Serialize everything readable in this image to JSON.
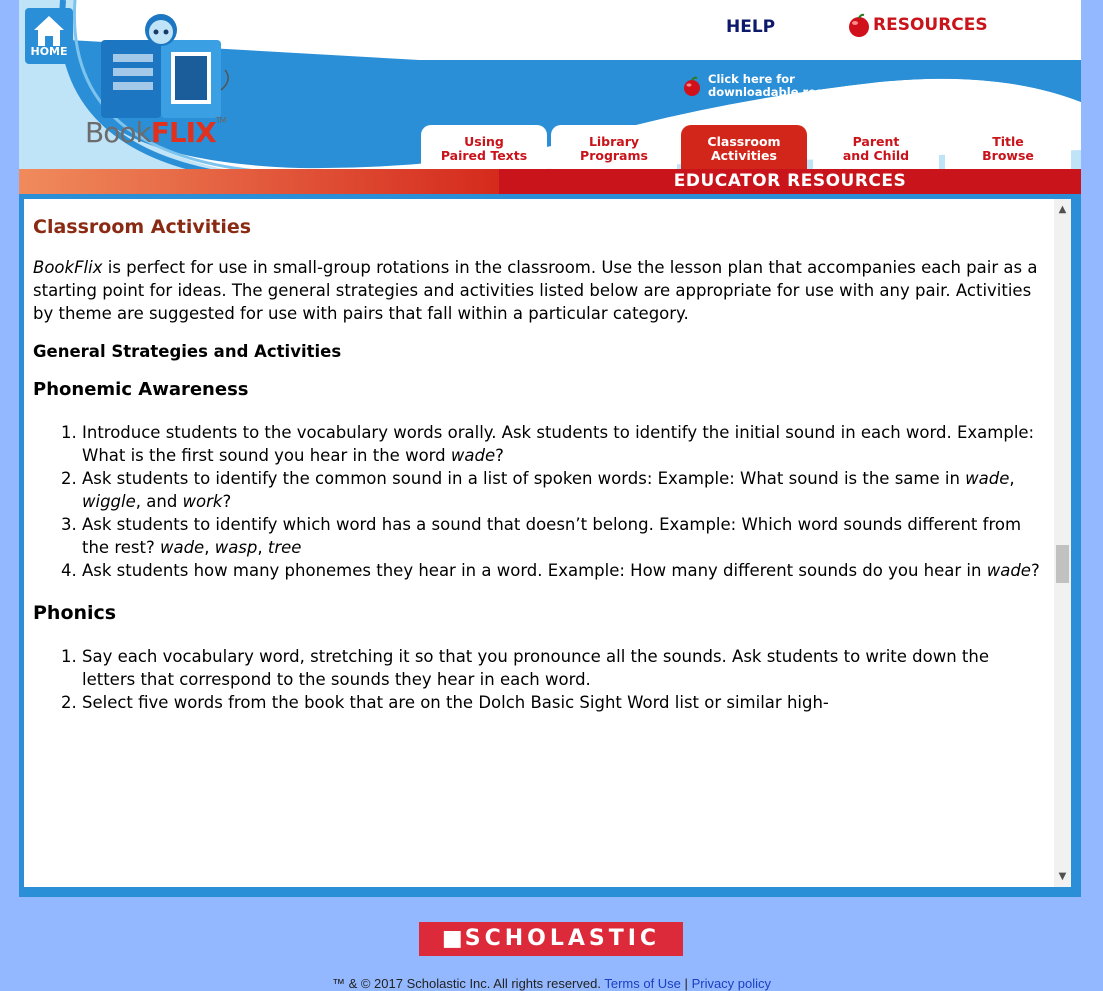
{
  "header": {
    "home_label": "HOME",
    "help_label": "HELP",
    "resources_label": "RESOURCES",
    "download_line1": "Click here for",
    "download_line2": "downloadable resources",
    "logo_book": "Book",
    "logo_flix": "FLIX",
    "logo_tm": "TM",
    "section_label": "EDUCATOR RESOURCES"
  },
  "tabs": [
    {
      "line1": "Using",
      "line2": "Paired Texts",
      "active": false
    },
    {
      "line1": "Library",
      "line2": "Programs",
      "active": false
    },
    {
      "line1": "Classroom",
      "line2": "Activities",
      "active": true
    },
    {
      "line1": "Parent",
      "line2": "and Child",
      "active": false
    },
    {
      "line1": "Title",
      "line2": "Browse",
      "active": false
    }
  ],
  "content": {
    "title": "Classroom Activities",
    "intro_italic": "BookFlix",
    "intro_rest": " is perfect for use in small-group rotations in the classroom. Use the lesson plan that accompanies each pair as a starting point for ideas. The general strategies and activities listed below are appropriate for use with any pair. Activities by theme are suggested for use with pairs that fall within a particular category.",
    "general_heading": "General Strategies and Activities",
    "phonemic_heading": "Phonemic Awareness",
    "phonemic_items": [
      {
        "text": "Introduce students to the vocabulary words orally. Ask students to identify the initial sound in each word. Example: What is the first sound you hear in the word ",
        "em": "wade",
        "tail": "?"
      },
      {
        "text": "Ask students to identify the common sound in a list of spoken words: Example: What sound is the same in ",
        "em1": "wade",
        "sep1": ", ",
        "em2": "wiggle",
        "sep2": ", and ",
        "em3": "work",
        "tail": "?"
      },
      {
        "text": "Ask students to identify which word has a sound that doesn’t belong. Example: Which word sounds different from the rest? ",
        "em1": "wade",
        "sep1": ", ",
        "em2": "wasp",
        "sep2": ", ",
        "em3": "tree"
      },
      {
        "text": "Ask students how many phonemes they hear in a word. Example: How many different sounds do you hear in ",
        "em": "wade",
        "tail": "?"
      }
    ],
    "phonics_heading": "Phonics",
    "phonics_items": [
      "Say each vocabulary word, stretching it so that you pronounce all the sounds. Ask students to write down the letters that correspond to the sounds they hear in each word.",
      "Select five words from the book that are on the Dolch Basic Sight Word list or similar high-"
    ]
  },
  "footer": {
    "brand": "SCHOLASTIC",
    "copyright": "™ & © 2017 Scholastic Inc. All rights reserved.",
    "terms_label": "Terms of Use",
    "separator": "|",
    "privacy_label": "Privacy policy"
  },
  "colors": {
    "page_bg": "#94b8ff",
    "header_blue": "#2a8fd6",
    "brand_red": "#c8141a",
    "title_brown": "#8b2a12"
  }
}
